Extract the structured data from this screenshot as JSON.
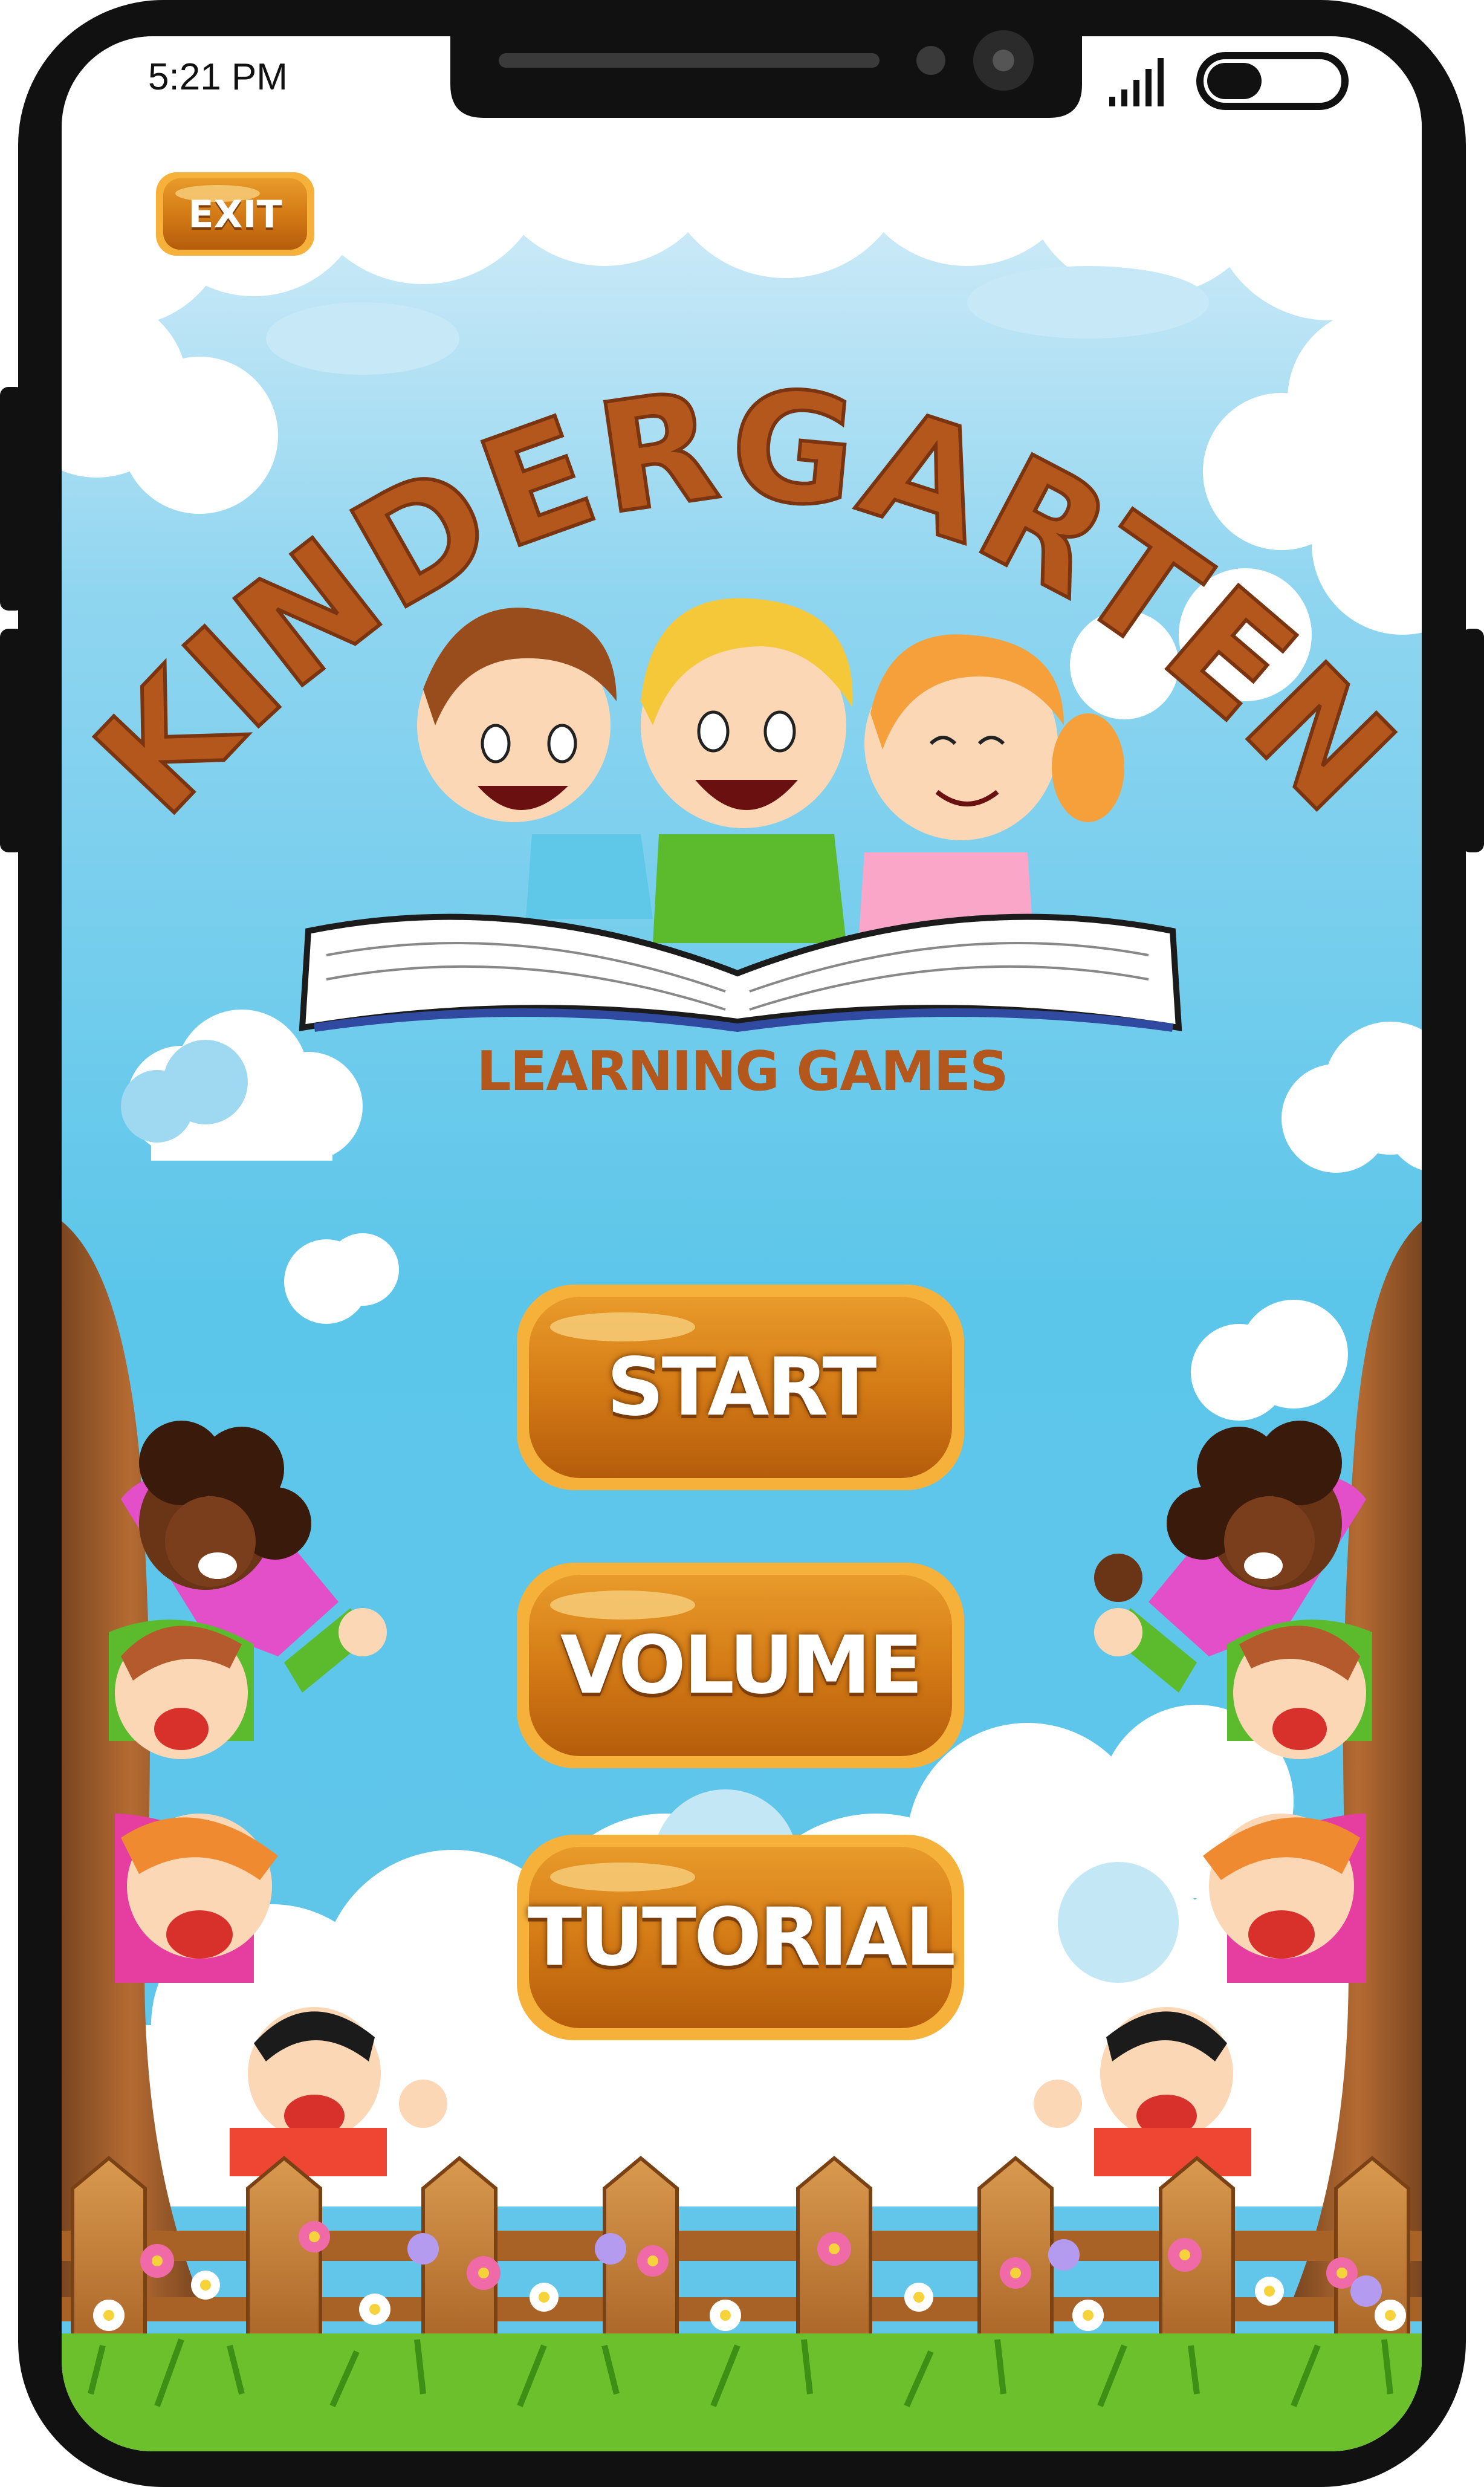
{
  "status_bar": {
    "time": "5:21 PM",
    "signal_icon": "signal-bars-icon",
    "battery_icon": "battery-icon"
  },
  "app": {
    "title": "KINDERGARTEN",
    "subtitle": "LEARNING GAMES",
    "exit_label": "EXIT"
  },
  "menu": {
    "start_label": "START",
    "volume_label": "VOLUME",
    "tutorial_label": "TUTORIAL"
  },
  "colors": {
    "sky": "#5cc6ea",
    "button_orange": "#d97f17",
    "button_border": "#f6b13a",
    "title_brown": "#b4571d",
    "phone_frame": "#111111"
  }
}
